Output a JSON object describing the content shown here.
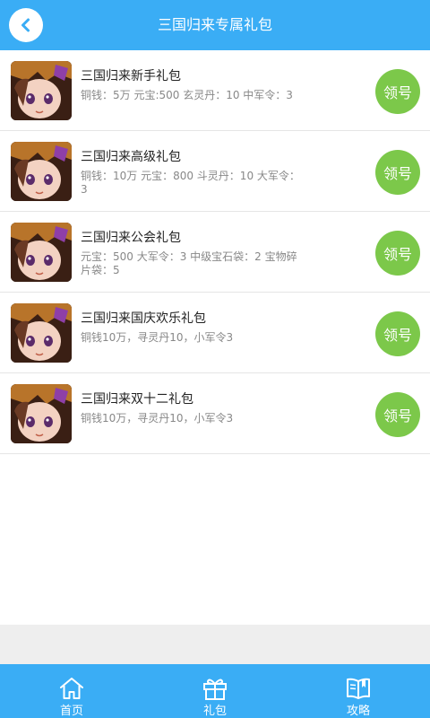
{
  "header": {
    "title": "三国归来专属礼包",
    "back_icon": "chevron-left-icon"
  },
  "colors": {
    "primary": "#3aadf5",
    "claim_button": "#7cc84a",
    "title_text": "#222222",
    "desc_text": "#888888"
  },
  "gifts": [
    {
      "title": "三国归来新手礼包",
      "desc": "铜钱：5万 元宝:500 玄灵丹：10 中军令：3",
      "button": "领号"
    },
    {
      "title": "三国归来高级礼包",
      "desc": "铜钱：10万 元宝：800 斗灵丹：10 大军令：3",
      "button": "领号"
    },
    {
      "title": "三国归来公会礼包",
      "desc": "元宝：500 大军令：3 中级宝石袋：2 宝物碎片袋：5",
      "button": "领号"
    },
    {
      "title": "三国归来国庆欢乐礼包",
      "desc": "铜钱10万，寻灵丹10，小军令3",
      "button": "领号"
    },
    {
      "title": "三国归来双十二礼包",
      "desc": "铜钱10万，寻灵丹10，小军令3",
      "button": "领号"
    }
  ],
  "tabs": [
    {
      "label": "首页",
      "icon": "home-icon"
    },
    {
      "label": "礼包",
      "icon": "gift-icon"
    },
    {
      "label": "攻略",
      "icon": "book-icon"
    }
  ]
}
